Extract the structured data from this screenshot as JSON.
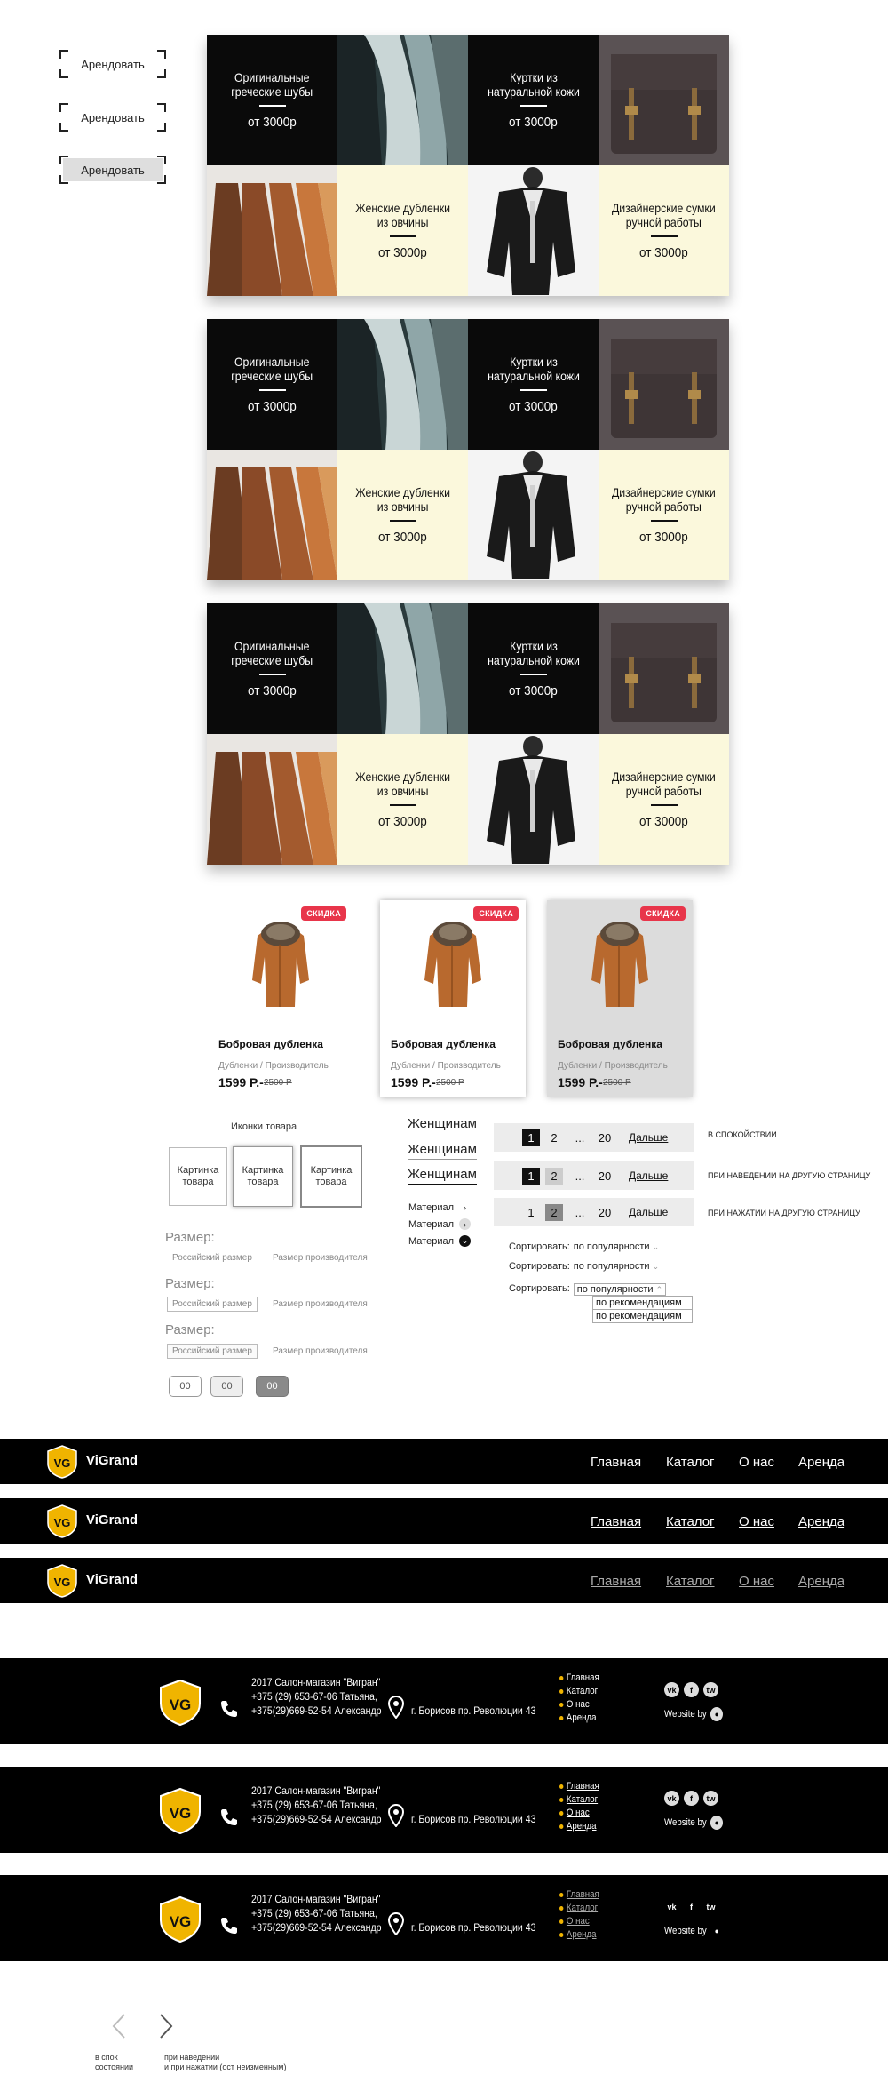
{
  "rent_buttons": [
    "Арендовать",
    "Арендовать",
    "Арендовать"
  ],
  "categories": {
    "cell1": {
      "title": [
        "Оригинальные",
        "греческие шубы"
      ],
      "price": "от 3000р"
    },
    "cell2": {
      "title": [
        "Куртки из",
        "натуральной кожи"
      ],
      "price": "от 3000р"
    },
    "cell3": {
      "title": [
        "Женские дубленки",
        "из овчины"
      ],
      "price": "от 3000р"
    },
    "cell4": {
      "title": [
        "Дизайнерские сумки",
        "ручной работы"
      ],
      "price": "от 3000р"
    }
  },
  "product": {
    "badge": "СКИДКА",
    "name": "Бобровая дубленка",
    "sub": "Дубленки / Производитель",
    "price": "1599 Р.-",
    "old_price": "2500 Р"
  },
  "icons_section": {
    "title": "Иконки товара",
    "thumb": [
      "Картинка",
      "товара"
    ]
  },
  "size": {
    "label": "Размер:",
    "russian": "Российский размер",
    "maker": "Размер производителя",
    "numbers": [
      "00",
      "00",
      "00"
    ]
  },
  "filters": {
    "women": "Женщинам",
    "material": "Материал"
  },
  "pagination": {
    "pages": [
      "1",
      "2",
      "...",
      "20"
    ],
    "next": "Дальше",
    "states": [
      "в спокойствии",
      "при наведении на другую страницу",
      "при нажатии на другую страницу"
    ]
  },
  "sort": {
    "label": "Сортировать:",
    "value": "по популярности",
    "options": [
      "по рекомендациям",
      "по рекомендациям"
    ]
  },
  "header": {
    "brand": "ViGrand",
    "nav": [
      "Главная",
      "Каталог",
      "О нас",
      "Аренда"
    ]
  },
  "footer": {
    "copy": "2017 Салон-магазин \"Вигран\"",
    "phone1": "+375 (29) 653-67-06 Татьяна,",
    "phone2": "+375(29)669-52-54 Александр",
    "address": "г. Борисов пр. Революции 43",
    "nav": [
      "Главная",
      "Каталог",
      "О нас",
      "Аренда"
    ],
    "social": [
      "vk",
      "f",
      "tw"
    ],
    "website": "Website by"
  },
  "arrows": {
    "caption_left": [
      "в спок",
      "состоянии"
    ],
    "caption_right": [
      "при наведении",
      "и при нажатии (ост неизменным)"
    ]
  },
  "colors": {
    "accent": "#f0b400",
    "badge": "#e8354a",
    "cream": "#fbf8dc"
  }
}
